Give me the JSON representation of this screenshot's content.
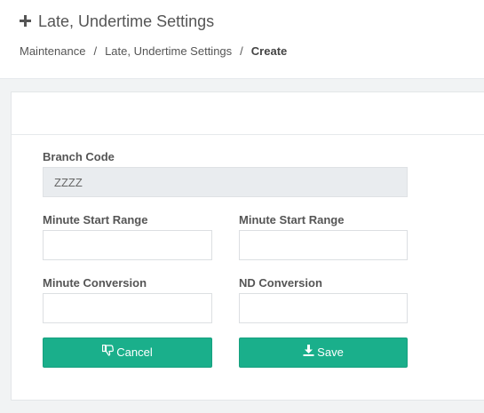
{
  "header": {
    "title": "Late, Undertime Settings",
    "breadcrumb": {
      "item1": "Maintenance",
      "item2": "Late, Undertime Settings",
      "active": "Create",
      "separator": "/"
    }
  },
  "form": {
    "branch_code_label": "Branch Code",
    "branch_code_value": "ZZZZ",
    "minute_start_label_1": "Minute Start Range",
    "minute_start_label_2": "Minute Start Range",
    "minute_conversion_label": "Minute Conversion",
    "nd_conversion_label": "ND Conversion"
  },
  "buttons": {
    "cancel": "Cancel",
    "save": "Save"
  },
  "colors": {
    "accent": "#1aaf8b",
    "disabled_field": "#e9ecef",
    "background": "#f1f3f4"
  }
}
